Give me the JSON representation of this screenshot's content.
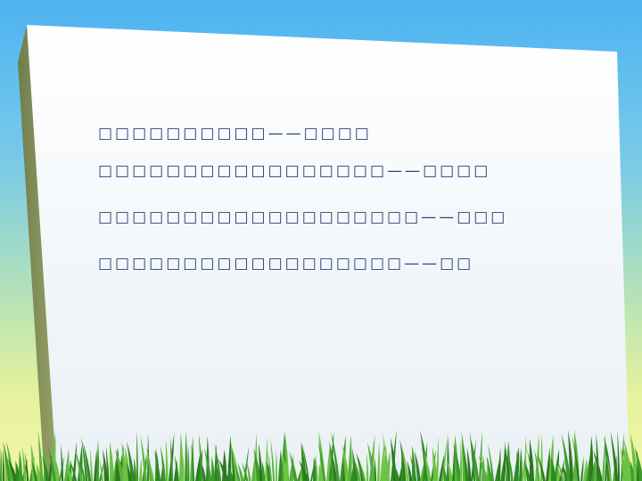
{
  "slide": {
    "lines": [
      {
        "text": "□□□□□□□□□□",
        "dash": "——",
        "tail": "□□□□"
      },
      {
        "text": "□□□□□□□□□□□□□□□□□ ",
        "dash": "——",
        "tail": "□□□□"
      },
      {
        "text": "□□□□□□□□□□□□□□□□□□□",
        "dash": "——",
        "tail": "□□□"
      },
      {
        "text": "□□□□□□□□□□□□□□□□□□",
        "dash": "——",
        "tail": "□□"
      }
    ]
  },
  "colors": {
    "text": "#2a3f7a",
    "board": "#f4f8fb",
    "board_edge": "#7d8a5a",
    "grass": "#3f9a2c"
  }
}
